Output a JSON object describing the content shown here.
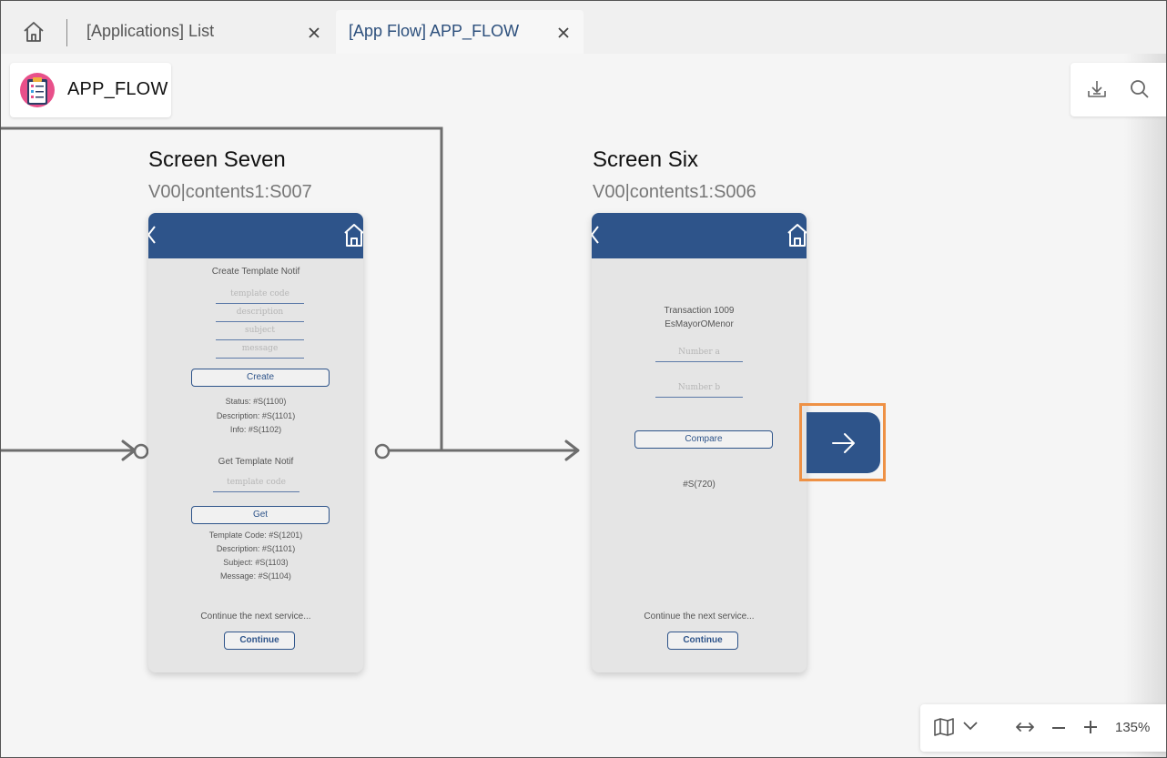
{
  "tabs": [
    {
      "label": "[Applications] List",
      "active": false
    },
    {
      "label": "[App Flow] APP_FLOW",
      "active": true
    }
  ],
  "app": {
    "title": "APP_FLOW"
  },
  "screens": [
    {
      "title": "Screen Seven",
      "code": "V00|contents1:S007",
      "header_text": "Create Template Notif",
      "fields": [
        "template code",
        "description",
        "subject",
        "message"
      ],
      "create_button": "Create",
      "create_results": [
        "Status: #S(1100)",
        "Description: #S(1101)",
        "Info: #S(1102)"
      ],
      "get_header": "Get Template Notif",
      "get_field": "template code",
      "get_button": "Get",
      "get_results": [
        "Template Code: #S(1201)",
        "Description: #S(1101)",
        "Subject: #S(1103)",
        "Message: #S(1104)"
      ],
      "footer_text": "Continue the next service...",
      "continue_button": "Continue"
    },
    {
      "title": "Screen Six",
      "code": "V00|contents1:S006",
      "header_line1": "Transaction 1009",
      "header_line2": "EsMayorOMenor",
      "fields": [
        "Number a",
        "Number b"
      ],
      "compare_button": "Compare",
      "result": "#S(720)",
      "footer_text": "Continue the next service...",
      "continue_button": "Continue"
    }
  ],
  "zoom": {
    "level": "135%"
  },
  "colors": {
    "accent": "#2e548a",
    "highlight": "#ee9145",
    "tab_active": "#2c4f7c"
  },
  "icons": [
    "home-icon",
    "close-icon",
    "checklist-icon",
    "download-icon",
    "search-icon",
    "back-icon",
    "arrow-right-icon",
    "map-icon",
    "chevron-down-icon",
    "fit-width-icon",
    "zoom-out-icon",
    "zoom-in-icon"
  ]
}
